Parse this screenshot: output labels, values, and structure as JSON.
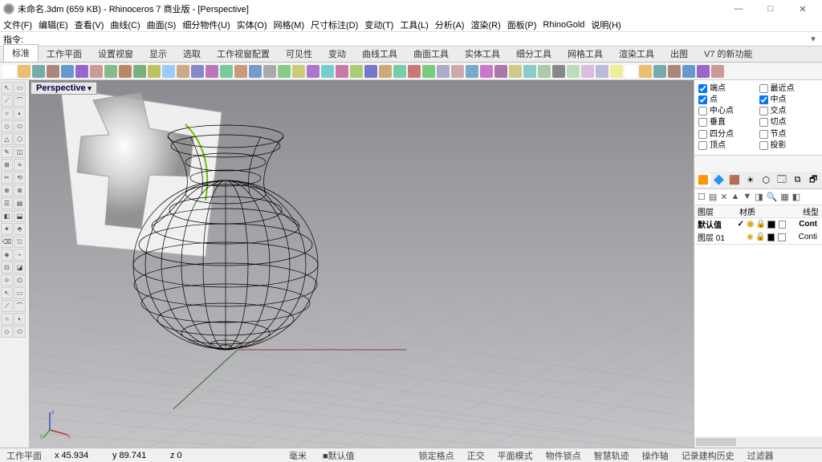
{
  "title": "未命名.3dm (659 KB) - Rhinoceros 7 商业版 - [Perspective]",
  "menus": [
    "文件(F)",
    "编辑(E)",
    "查看(V)",
    "曲线(C)",
    "曲面(S)",
    "细分物件(U)",
    "实体(O)",
    "网格(M)",
    "尺寸标注(D)",
    "变动(T)",
    "工具(L)",
    "分析(A)",
    "渲染(R)",
    "面板(P)",
    "RhinoGold",
    "说明(H)"
  ],
  "cmd_label": "指令:",
  "tabs": [
    "标准",
    "工作平面",
    "设置视窗",
    "显示",
    "选取",
    "工作视窗配置",
    "可见性",
    "变动",
    "曲线工具",
    "曲面工具",
    "实体工具",
    "细分工具",
    "网格工具",
    "渲染工具",
    "出图",
    "V7 的新功能"
  ],
  "active_tab": 0,
  "viewport_name": "Perspective",
  "osnap": {
    "col1": [
      {
        "label": "端点",
        "checked": true
      },
      {
        "label": "点",
        "checked": true
      },
      {
        "label": "中心点",
        "checked": false
      },
      {
        "label": "垂直",
        "checked": false
      },
      {
        "label": "四分点",
        "checked": false
      },
      {
        "label": "顶点",
        "checked": false
      }
    ],
    "col2": [
      {
        "label": "最近点",
        "checked": false
      },
      {
        "label": "中点",
        "checked": true
      },
      {
        "label": "交点",
        "checked": false
      },
      {
        "label": "切点",
        "checked": false
      },
      {
        "label": "节点",
        "checked": false
      },
      {
        "label": "投影",
        "checked": false
      }
    ]
  },
  "layer_header": {
    "c1": "图层",
    "c2": "材质",
    "c3": "线型"
  },
  "layers": [
    {
      "name": "默认值",
      "bold": true,
      "current": true,
      "on": true,
      "color": "#000000",
      "linetype": "Cont"
    },
    {
      "name": "图层 01",
      "bold": false,
      "current": false,
      "on": true,
      "color": "#000000",
      "linetype": "Conti"
    }
  ],
  "status": {
    "mode": "工作平面",
    "x": "x 45.934",
    "y": "y 89.741",
    "z": "z 0",
    "mm": "毫米",
    "layer": "■默认值",
    "items": [
      "锁定格点",
      "正交",
      "平面模式",
      "物件锁点",
      "智慧轨迹",
      "操作轴",
      "记录建构历史",
      "过滤器"
    ]
  },
  "panel_icons": [
    "🟧",
    "🔷",
    "🟫",
    "☀",
    "⬡",
    "🗔",
    "⧉",
    "🗗"
  ],
  "layer_tool_icons": [
    "☐",
    "▤",
    "✕",
    "▲",
    "▼",
    "◨",
    "🔍",
    "▦",
    "◧"
  ]
}
